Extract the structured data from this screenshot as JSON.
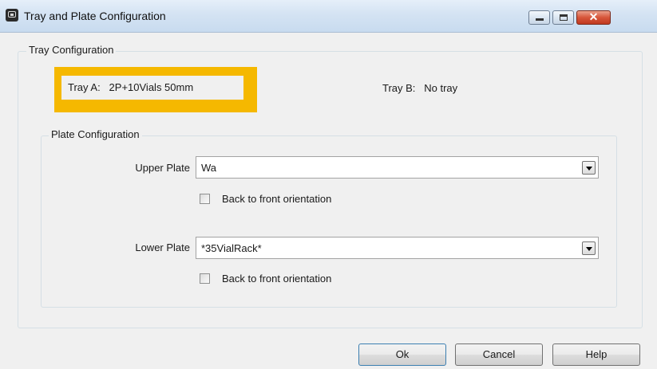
{
  "window": {
    "title": "Tray and Plate Configuration",
    "icon": "tray-icon",
    "controls": {
      "minimize": "minimize",
      "maximize": "maximize",
      "close": "✕"
    }
  },
  "tray_config": {
    "group_label": "Tray Configuration",
    "tray_a": {
      "label": "Tray A:",
      "value": "2P+10Vials 50mm",
      "highlighted": true,
      "highlight_color": "#f5b800"
    },
    "tray_b": {
      "label": "Tray B:",
      "value": "No tray"
    }
  },
  "plate_config": {
    "group_label": "Plate Configuration",
    "upper": {
      "label": "Upper Plate",
      "value": "Wa",
      "checkbox_label": "Back to front orientation",
      "checked": false
    },
    "lower": {
      "label": "Lower Plate",
      "value": "*35VialRack*",
      "checkbox_label": "Back to front orientation",
      "checked": false
    }
  },
  "buttons": {
    "ok": "Ok",
    "cancel": "Cancel",
    "help": "Help"
  }
}
